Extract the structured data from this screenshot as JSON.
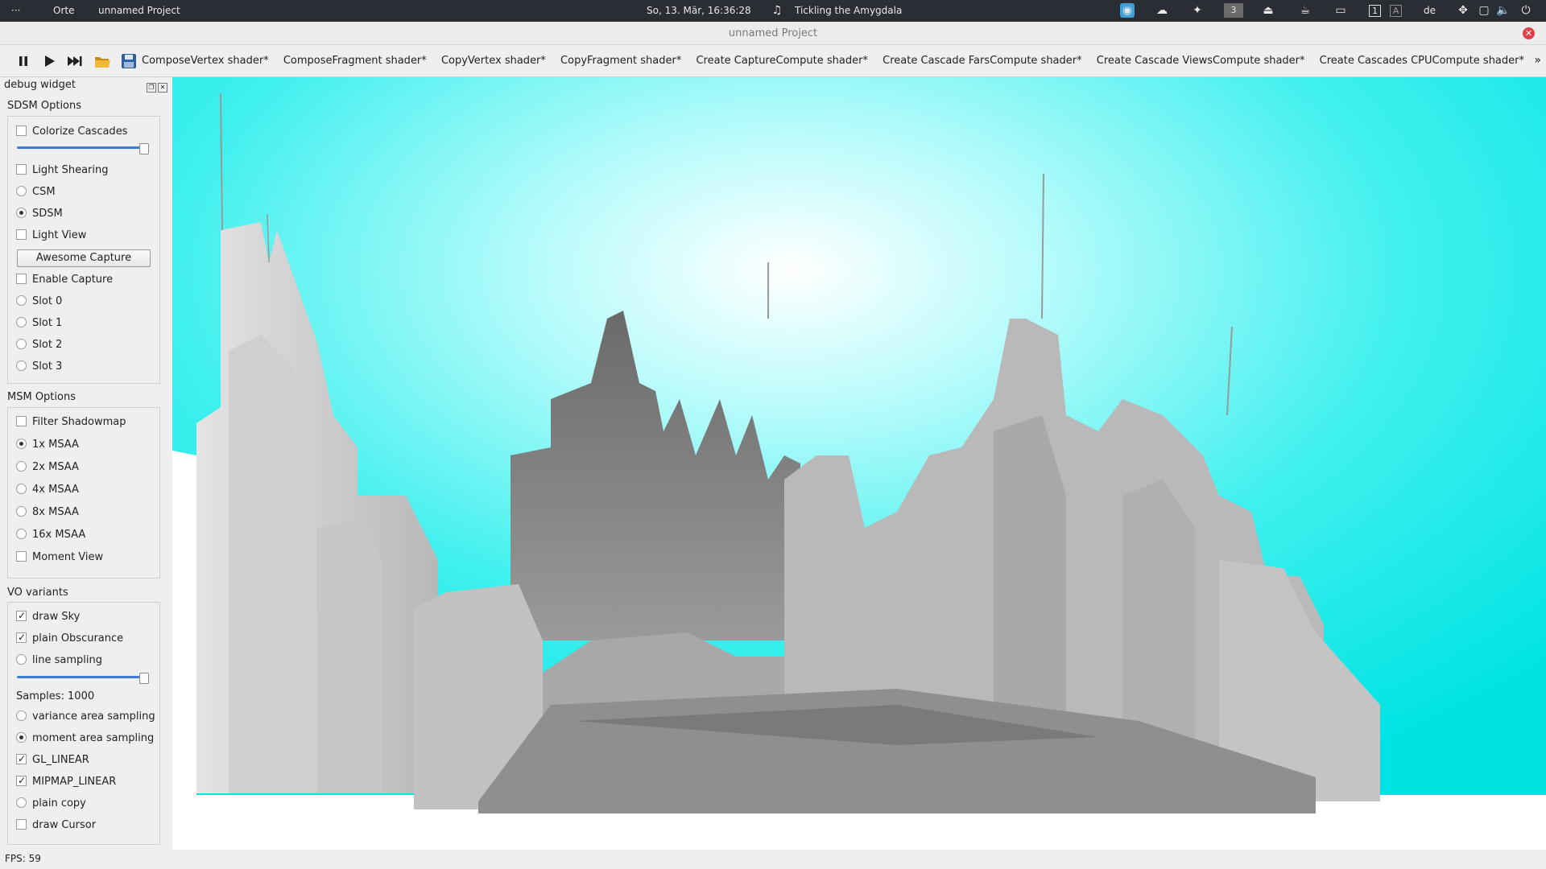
{
  "system_panel": {
    "menu_dots": "···",
    "places": "Orte",
    "app_title": "unnamed Project",
    "datetime": "So, 13. Mär, 16:36:28",
    "music_track": "Tickling the Amygdala",
    "workspace": "3",
    "keyboard_layout": "de"
  },
  "window": {
    "title": "unnamed Project"
  },
  "toolbar": {
    "tabs": [
      "ComposeVertex shader*",
      "ComposeFragment shader*",
      "CopyVertex shader*",
      "CopyFragment shader*",
      "Create CaptureCompute shader*",
      "Create Cascade FarsCompute shader*",
      "Create Cascade ViewsCompute shader*",
      "Create Cascades CPUCompute shader*"
    ],
    "overflow": "»"
  },
  "dock": {
    "title": "debug widget",
    "sdsm": {
      "title": "SDSM Options",
      "colorize_cascades": "Colorize Cascades",
      "light_shearing": "Light Shearing",
      "csm": "CSM",
      "sdsm": "SDSM",
      "light_view": "Light View",
      "awesome_capture": "Awesome Capture",
      "enable_capture": "Enable Capture",
      "slot0": "Slot 0",
      "slot1": "Slot 1",
      "slot2": "Slot 2",
      "slot3": "Slot 3"
    },
    "msm": {
      "title": "MSM Options",
      "filter_shadowmap": "Filter Shadowmap",
      "msaa1": "1x MSAA",
      "msaa2": "2x MSAA",
      "msaa4": "4x MSAA",
      "msaa8": "8x MSAA",
      "msaa16": "16x MSAA",
      "moment_view": "Moment View"
    },
    "vo": {
      "title": "VO variants",
      "draw_sky": "draw Sky",
      "plain_obscurance": "plain Obscurance",
      "line_sampling": "line sampling",
      "samples": "Samples: 1000",
      "variance_area": "variance area sampling",
      "moment_area": "moment area sampling",
      "gl_linear": "GL_LINEAR",
      "mipmap_linear": "MIPMAP_LINEAR",
      "plain_copy": "plain copy",
      "draw_cursor": "draw Cursor"
    }
  },
  "status": {
    "fps": "FPS: 59"
  },
  "colors": {
    "sky": "#00e5e5",
    "panel": "#2b2d34",
    "accent": "#3d7bd6"
  }
}
